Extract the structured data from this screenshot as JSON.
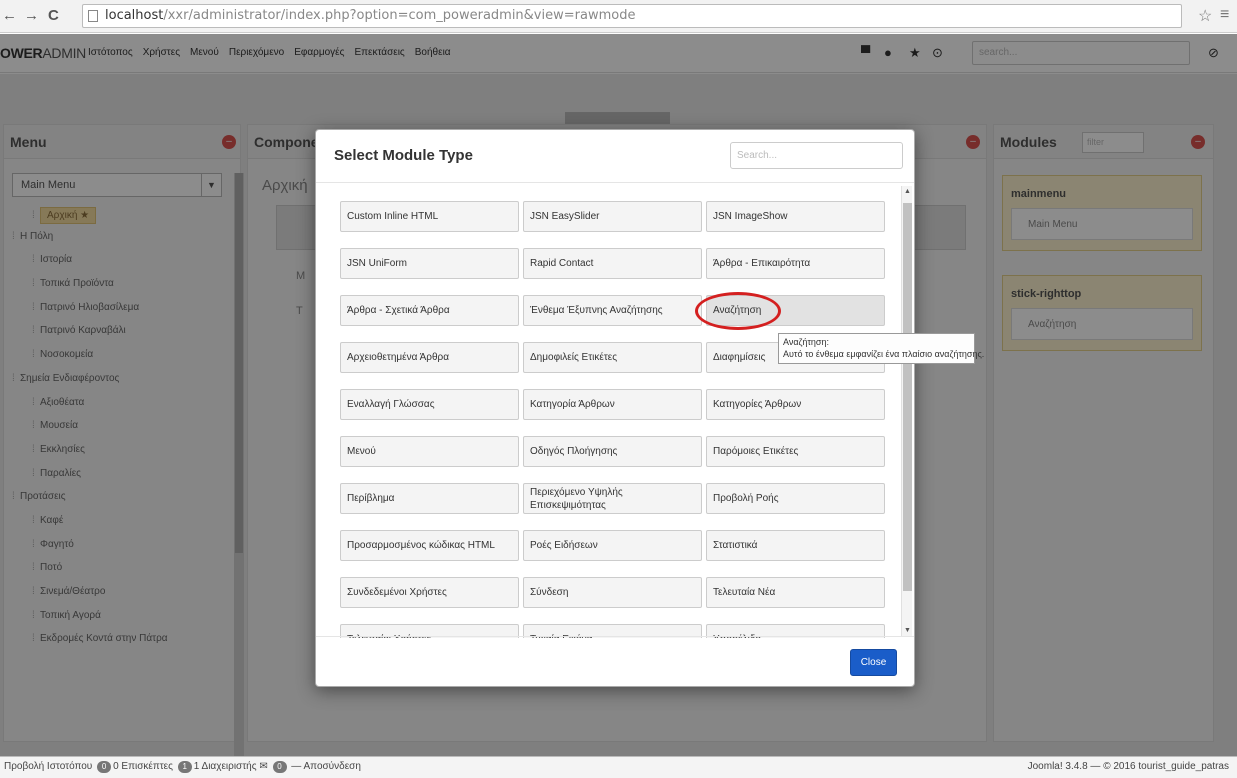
{
  "browser": {
    "url_host": "localhost",
    "url_path": "/xxr/administrator/index.php?option=com_poweradmin&view=rawmode"
  },
  "app": {
    "brand_prefix": "OWER",
    "brand_suffix": "ADMIN",
    "nav": [
      "Ιστότοπος",
      "Χρήστες",
      "Μενού",
      "Περιεχόμενο",
      "Εφαρμογές",
      "Επεκτάσεις",
      "Βοήθεια"
    ],
    "search_placeholder": "search..."
  },
  "left_panel": {
    "title": "Menu",
    "select_value": "Main Menu",
    "items": [
      {
        "label": "Αρχική ★",
        "active": true,
        "level": 1
      },
      {
        "label": "Η Πόλη",
        "level": 0
      },
      {
        "label": "Ιστορία",
        "level": 1
      },
      {
        "label": "Τοπικά Προϊόντα",
        "level": 1
      },
      {
        "label": "Πατρινό Ηλιοβασίλεμα",
        "level": 1
      },
      {
        "label": "Πατρινό Καρναβάλι",
        "level": 1
      },
      {
        "label": "Νοσοκομεία",
        "level": 1
      },
      {
        "label": "Σημεία Ενδιαφέροντος",
        "level": 0
      },
      {
        "label": "Αξιοθέατα",
        "level": 1
      },
      {
        "label": "Μουσεία",
        "level": 1
      },
      {
        "label": "Εκκλησίες",
        "level": 1
      },
      {
        "label": "Παραλίες",
        "level": 1
      },
      {
        "label": "Προτάσεις",
        "level": 0
      },
      {
        "label": "Καφέ",
        "level": 1
      },
      {
        "label": "Φαγητό",
        "level": 1
      },
      {
        "label": "Ποτό",
        "level": 1
      },
      {
        "label": "Σινεμά/Θέατρο",
        "level": 1
      },
      {
        "label": "Τοπική Αγορά",
        "level": 1
      },
      {
        "label": "Εκδρομές Κοντά στην Πάτρα",
        "level": 1
      }
    ]
  },
  "center_panel": {
    "title": "Compone",
    "heading": "Αρχική",
    "rows": [
      "M",
      "T"
    ]
  },
  "right_panel": {
    "title": "Modules",
    "filter_placeholder": "filter",
    "cards": [
      {
        "title": "mainmenu",
        "item": "Main Menu"
      },
      {
        "title": "stick-righttop",
        "item": "Αναζήτηση"
      }
    ]
  },
  "modal": {
    "title": "Select Module Type",
    "search_placeholder": "Search...",
    "close_label": "Close",
    "modules": [
      "Custom Inline HTML",
      "JSN EasySlider",
      "JSN ImageShow",
      "JSN UniForm",
      "Rapid Contact",
      "Άρθρα - Επικαιρότητα",
      "Άρθρα - Σχετικά Άρθρα",
      "Ένθεμα Έξυπνης Αναζήτησης",
      "Αναζήτηση",
      "Αρχειοθετημένα Άρθρα",
      "Δημοφιλείς Ετικέτες",
      "Διαφημίσεις",
      "Εναλλαγή Γλώσσας",
      "Κατηγορία Άρθρων",
      "Κατηγορίες Άρθρων",
      "Μενού",
      "Οδηγός Πλοήγησης",
      "Παρόμοιες Ετικέτες",
      "Περίβλημα",
      "Περιεχόμενο Υψηλής Επισκεψιμότητας",
      "Προβολή Ροής",
      "Προσαρμοσμένος κώδικας HTML",
      "Ροές Ειδήσεων",
      "Στατιστικά",
      "Συνδεδεμένοι Χρήστες",
      "Σύνδεση",
      "Τελευταία Νέα",
      "Τελευταίοι Χρήστες",
      "Τυχαία Εικόνα",
      "Υποσέλιδο"
    ],
    "tooltip_title": "Αναζήτηση:",
    "tooltip_text": "Αυτό το ένθεμα εμφανίζει ένα πλαίσιο αναζήτησης."
  },
  "status_bar": {
    "view_site": "Προβολή Ιστοτόπου",
    "visitors_count": "0",
    "visitors_label": "0 Επισκέπτες",
    "admins_count": "1",
    "admins_label": "1 Διαχειριστής",
    "messages_count": "0",
    "logout": "Αποσύνδεση",
    "footer": "Joomla! 3.4.8 — © 2016 tourist_guide_patras"
  }
}
